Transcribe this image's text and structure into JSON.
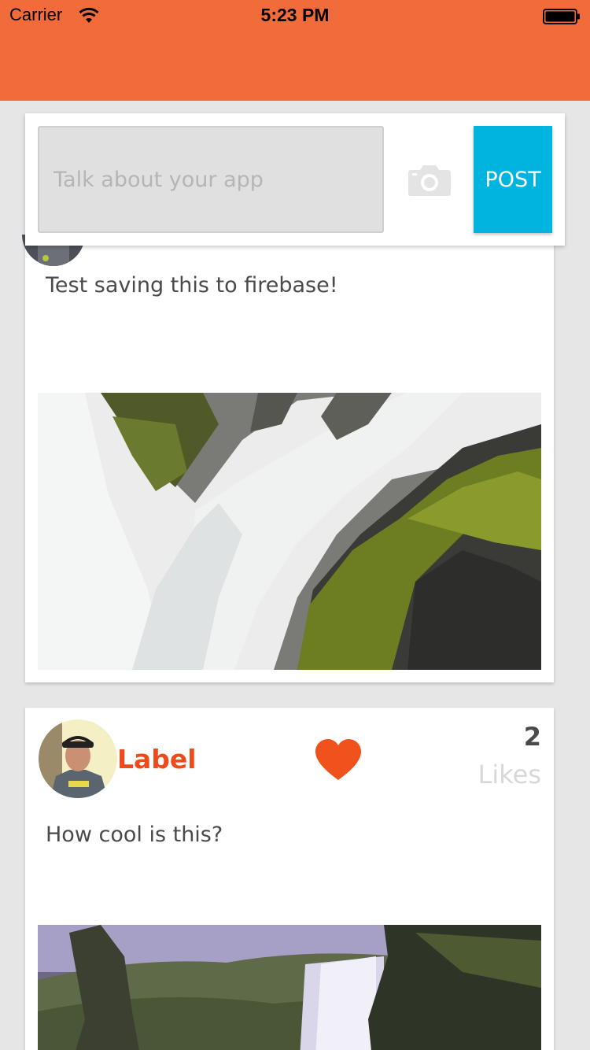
{
  "status_bar": {
    "carrier": "Carrier",
    "time": "5:23 PM"
  },
  "composer": {
    "placeholder": "Talk about your app",
    "value": "",
    "post_label": "POST",
    "camera_icon": "camera-icon"
  },
  "posts": [
    {
      "author": "",
      "caption": "Test saving this to firebase!",
      "likes": "",
      "likes_label": "",
      "image": "waterfall-closeup-photo"
    },
    {
      "author": "Label",
      "caption": "How cool is this?",
      "likes": "2",
      "likes_label": "Likes",
      "image": "waterfall-valley-photo"
    }
  ],
  "colors": {
    "nav": "#f26b3a",
    "accent": "#ee4a1b",
    "post_button": "#00b4e0",
    "background": "#e6e6e6"
  }
}
